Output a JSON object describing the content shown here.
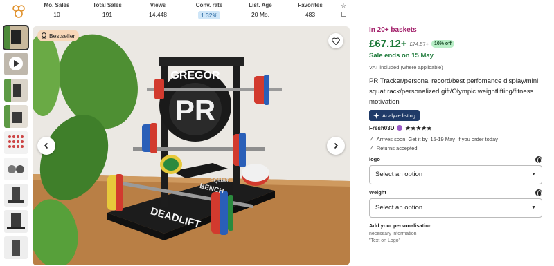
{
  "stats": [
    {
      "label": "Mo. Sales",
      "value": "10"
    },
    {
      "label": "Total Sales",
      "value": "191"
    },
    {
      "label": "Views",
      "value": "14,448"
    },
    {
      "label": "Conv. rate",
      "value": "1.32%"
    },
    {
      "label": "List. Age",
      "value": "20 Mo."
    },
    {
      "label": "Favorites",
      "value": "483"
    }
  ],
  "tools": {
    "star_icon": "☆"
  },
  "image": {
    "badge": "Bestseller",
    "model_texts": [
      "GREGOR",
      "PR",
      "DEADLIFT",
      "BENCH",
      "SQUAT"
    ]
  },
  "listing": {
    "baskets": "In 20+ baskets",
    "price": "£67.12+",
    "old_price": "£74.57+",
    "discount": "10% off",
    "sale_ends": "Sale ends on 15 May",
    "vat": "VAT included (where applicable)",
    "title": "PR Tracker/personal record/best perfomance display/mini squat rack/personalized gift/Olympic weightlifting/fitness motivation",
    "analyze_label": "Analyze listing",
    "shop_name": "Fresh03D",
    "stars": "★★★★★",
    "arrives_prefix": "Arrives soon! Get it by",
    "arrives_dates": "15-19 May",
    "arrives_suffix": "if you order today",
    "returns": "Returns accepted",
    "option_logo_label": "logo",
    "option_logo_value": "Select an option",
    "option_weight_label": "Weight",
    "option_weight_value": "Select an option",
    "personalisation_title": "Add your personalisation",
    "personalisation_line1": "necessary information",
    "personalisation_line2": "\"Text on Logo\""
  },
  "colors": {
    "price_green": "#1e7a3a",
    "basket_pink": "#a3216b",
    "analyze_bg": "#1f3a68"
  }
}
